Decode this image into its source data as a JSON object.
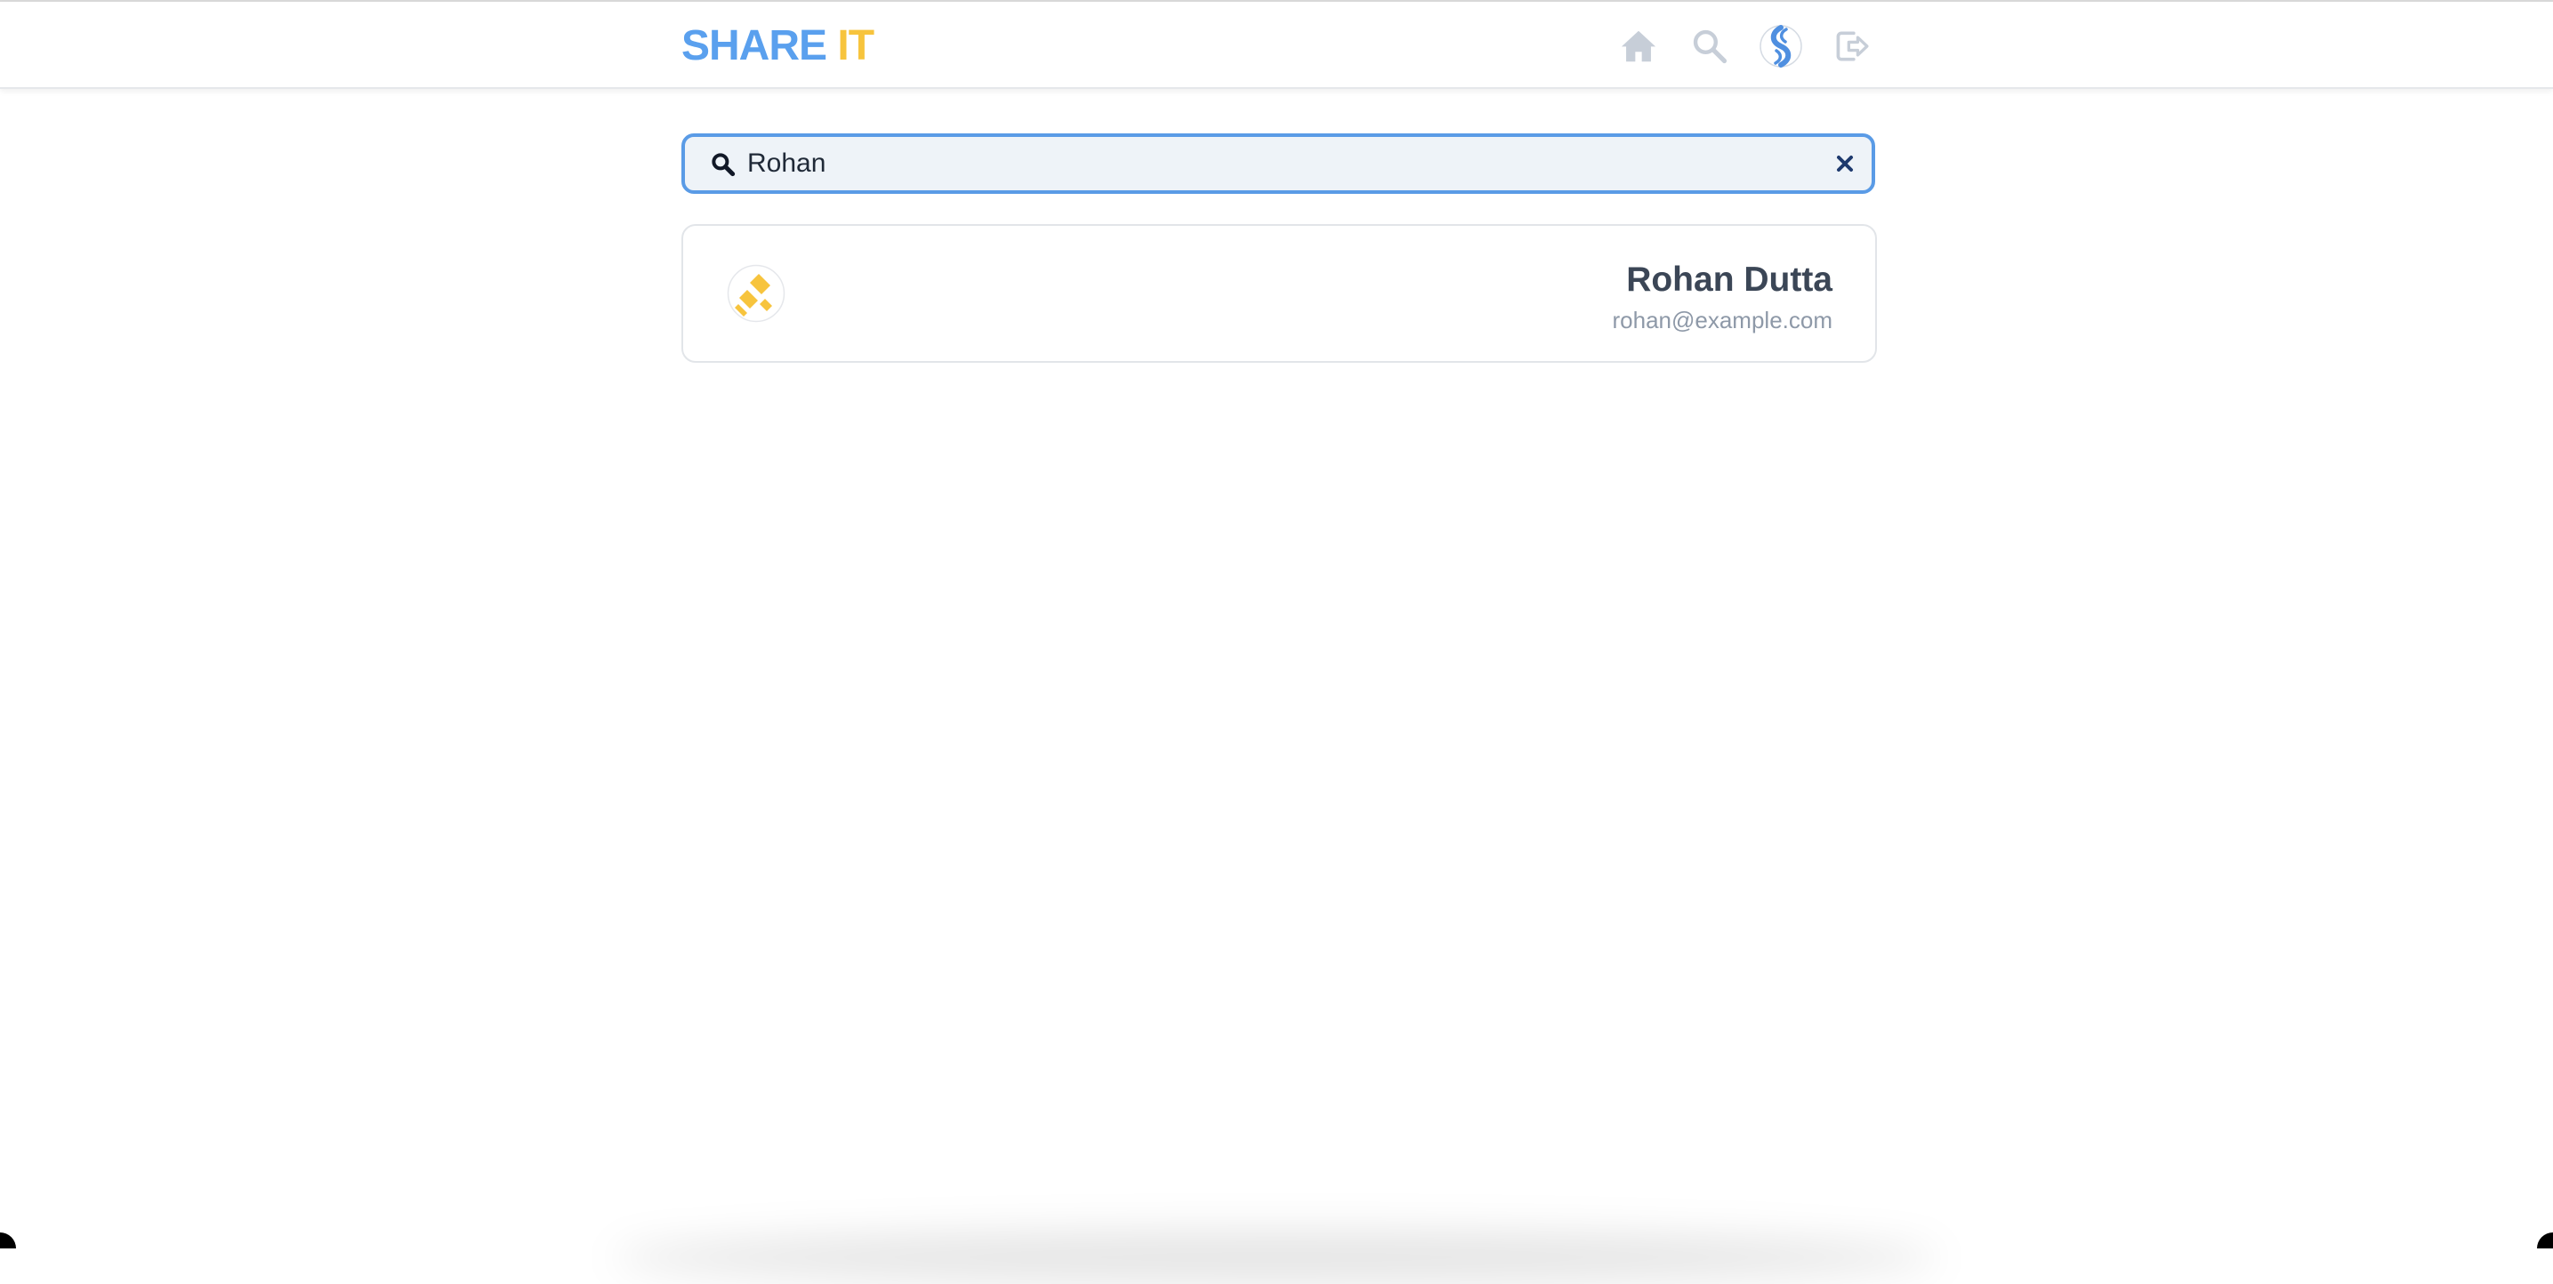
{
  "app": {
    "brand_part_1": "SHARE",
    "brand_part_2": "IT"
  },
  "nav": {
    "icons": [
      "home-icon",
      "search-icon",
      "profile-avatar-icon",
      "logout-icon"
    ]
  },
  "search": {
    "value": "Rohan",
    "placeholder": "",
    "icon": "search-icon",
    "clear_icon": "close-icon"
  },
  "results": [
    {
      "name": "Rohan Dutta",
      "email": "rohan@example.com",
      "avatar_icon": "user-avatar-icon"
    }
  ],
  "colors": {
    "brand_blue": "#5aa0ee",
    "brand_yellow": "#f7c43d",
    "nav_icon": "#c7ced8",
    "focus_border": "#5a9be6",
    "input_bg": "#eef3f8",
    "name_text": "#3b4656",
    "email_text": "#8e99a8"
  }
}
